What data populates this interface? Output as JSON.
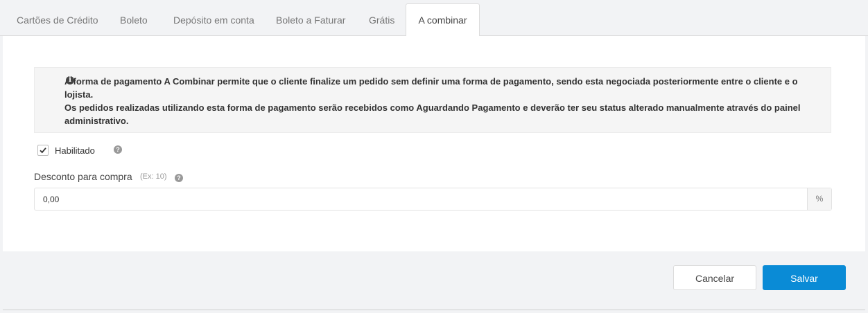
{
  "tabs": [
    {
      "label": "Cartões de Crédito",
      "active": false
    },
    {
      "label": "Boleto",
      "active": false
    },
    {
      "label": "Depósito em conta",
      "active": false
    },
    {
      "label": "Boleto a Faturar",
      "active": false
    },
    {
      "label": "Grátis",
      "active": false
    },
    {
      "label": "A combinar",
      "active": true
    }
  ],
  "info": {
    "icon": "info-circle-icon",
    "line1": "A forma de pagamento A Combinar permite que o cliente finalize um pedido sem definir uma forma de pagamento, sendo esta negociada posteriormente entre o cliente e o lojista.",
    "line2": "Os pedidos realizadas utilizando esta forma de pagamento serão recebidos como Aguardando Pagamento e deverão ter seu status alterado manualmente através do painel administrativo."
  },
  "enabled": {
    "label": "Habilitado",
    "checked": true,
    "help_icon": "question-circle-icon"
  },
  "discount": {
    "label": "Desconto para compra",
    "hint": "(Ex: 10)",
    "value": "0,00",
    "addon": "%",
    "help_icon": "question-circle-icon"
  },
  "footer": {
    "cancel_label": "Cancelar",
    "save_label": "Salvar"
  },
  "colors": {
    "primary": "#0a8bd6",
    "background": "#f2f3f5"
  }
}
